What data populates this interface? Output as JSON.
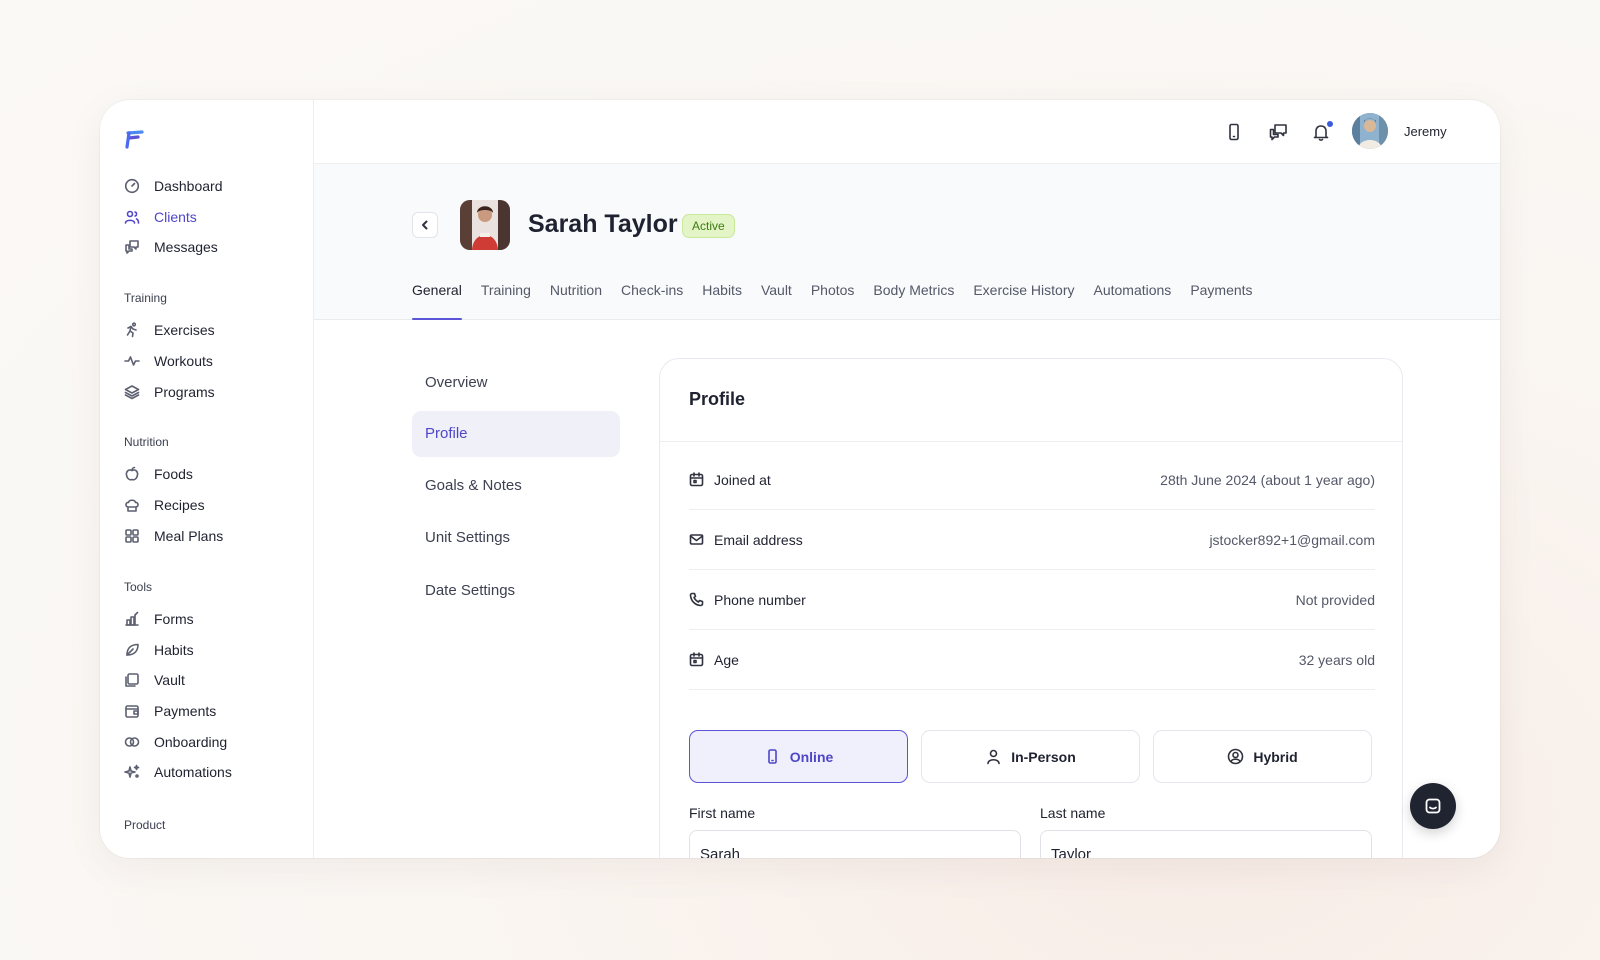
{
  "sidebar": {
    "items_top": [
      {
        "label": "Dashboard",
        "icon": "dashboard-icon"
      },
      {
        "label": "Clients",
        "icon": "clients-icon",
        "active": true
      },
      {
        "label": "Messages",
        "icon": "messages-icon"
      }
    ],
    "sections": [
      {
        "title": "Training",
        "items": [
          {
            "label": "Exercises",
            "icon": "running-icon"
          },
          {
            "label": "Workouts",
            "icon": "pulse-icon"
          },
          {
            "label": "Programs",
            "icon": "layers-icon"
          }
        ]
      },
      {
        "title": "Nutrition",
        "items": [
          {
            "label": "Foods",
            "icon": "apple-icon"
          },
          {
            "label": "Recipes",
            "icon": "chef-hat-icon"
          },
          {
            "label": "Meal Plans",
            "icon": "grid-icon"
          }
        ]
      },
      {
        "title": "Tools",
        "items": [
          {
            "label": "Forms",
            "icon": "form-icon"
          },
          {
            "label": "Habits",
            "icon": "leaf-icon"
          },
          {
            "label": "Vault",
            "icon": "folder-icon"
          },
          {
            "label": "Payments",
            "icon": "wallet-icon"
          },
          {
            "label": "Onboarding",
            "icon": "rings-icon"
          },
          {
            "label": "Automations",
            "icon": "sparkle-icon"
          }
        ]
      },
      {
        "title": "Product",
        "items": []
      }
    ]
  },
  "topbar": {
    "username": "Jeremy",
    "icons": [
      "mobile-icon",
      "chat-bubbles-icon",
      "bell-icon"
    ]
  },
  "client": {
    "name": "Sarah Taylor",
    "status": "Active"
  },
  "tabs": [
    "General",
    "Training",
    "Nutrition",
    "Check-ins",
    "Habits",
    "Vault",
    "Photos",
    "Body Metrics",
    "Exercise History",
    "Automations",
    "Payments"
  ],
  "active_tab": "General",
  "subnav": [
    "Overview",
    "Profile",
    "Goals & Notes",
    "Unit Settings",
    "Date Settings"
  ],
  "active_subnav": "Profile",
  "profile": {
    "title": "Profile",
    "rows": [
      {
        "label": "Joined at",
        "value": "28th June 2024 (about 1 year ago)",
        "icon": "calendar-icon"
      },
      {
        "label": "Email address",
        "value": "jstocker892+1@gmail.com",
        "icon": "mail-icon"
      },
      {
        "label": "Phone number",
        "value": "Not provided",
        "icon": "phone-icon"
      },
      {
        "label": "Age",
        "value": "32 years old",
        "icon": "calendar-icon"
      }
    ],
    "modes": [
      {
        "label": "Online",
        "icon": "mobile-icon",
        "active": true
      },
      {
        "label": "In-Person",
        "icon": "user-icon"
      },
      {
        "label": "Hybrid",
        "icon": "user-circle-icon"
      }
    ],
    "first_name_label": "First name",
    "first_name_value": "Sarah",
    "last_name_label": "Last name",
    "last_name_value": "Taylor"
  },
  "colors": {
    "accent": "#4f46c8",
    "active_badge_bg": "#e3f5c7",
    "active_badge_text": "#3e7b12"
  }
}
